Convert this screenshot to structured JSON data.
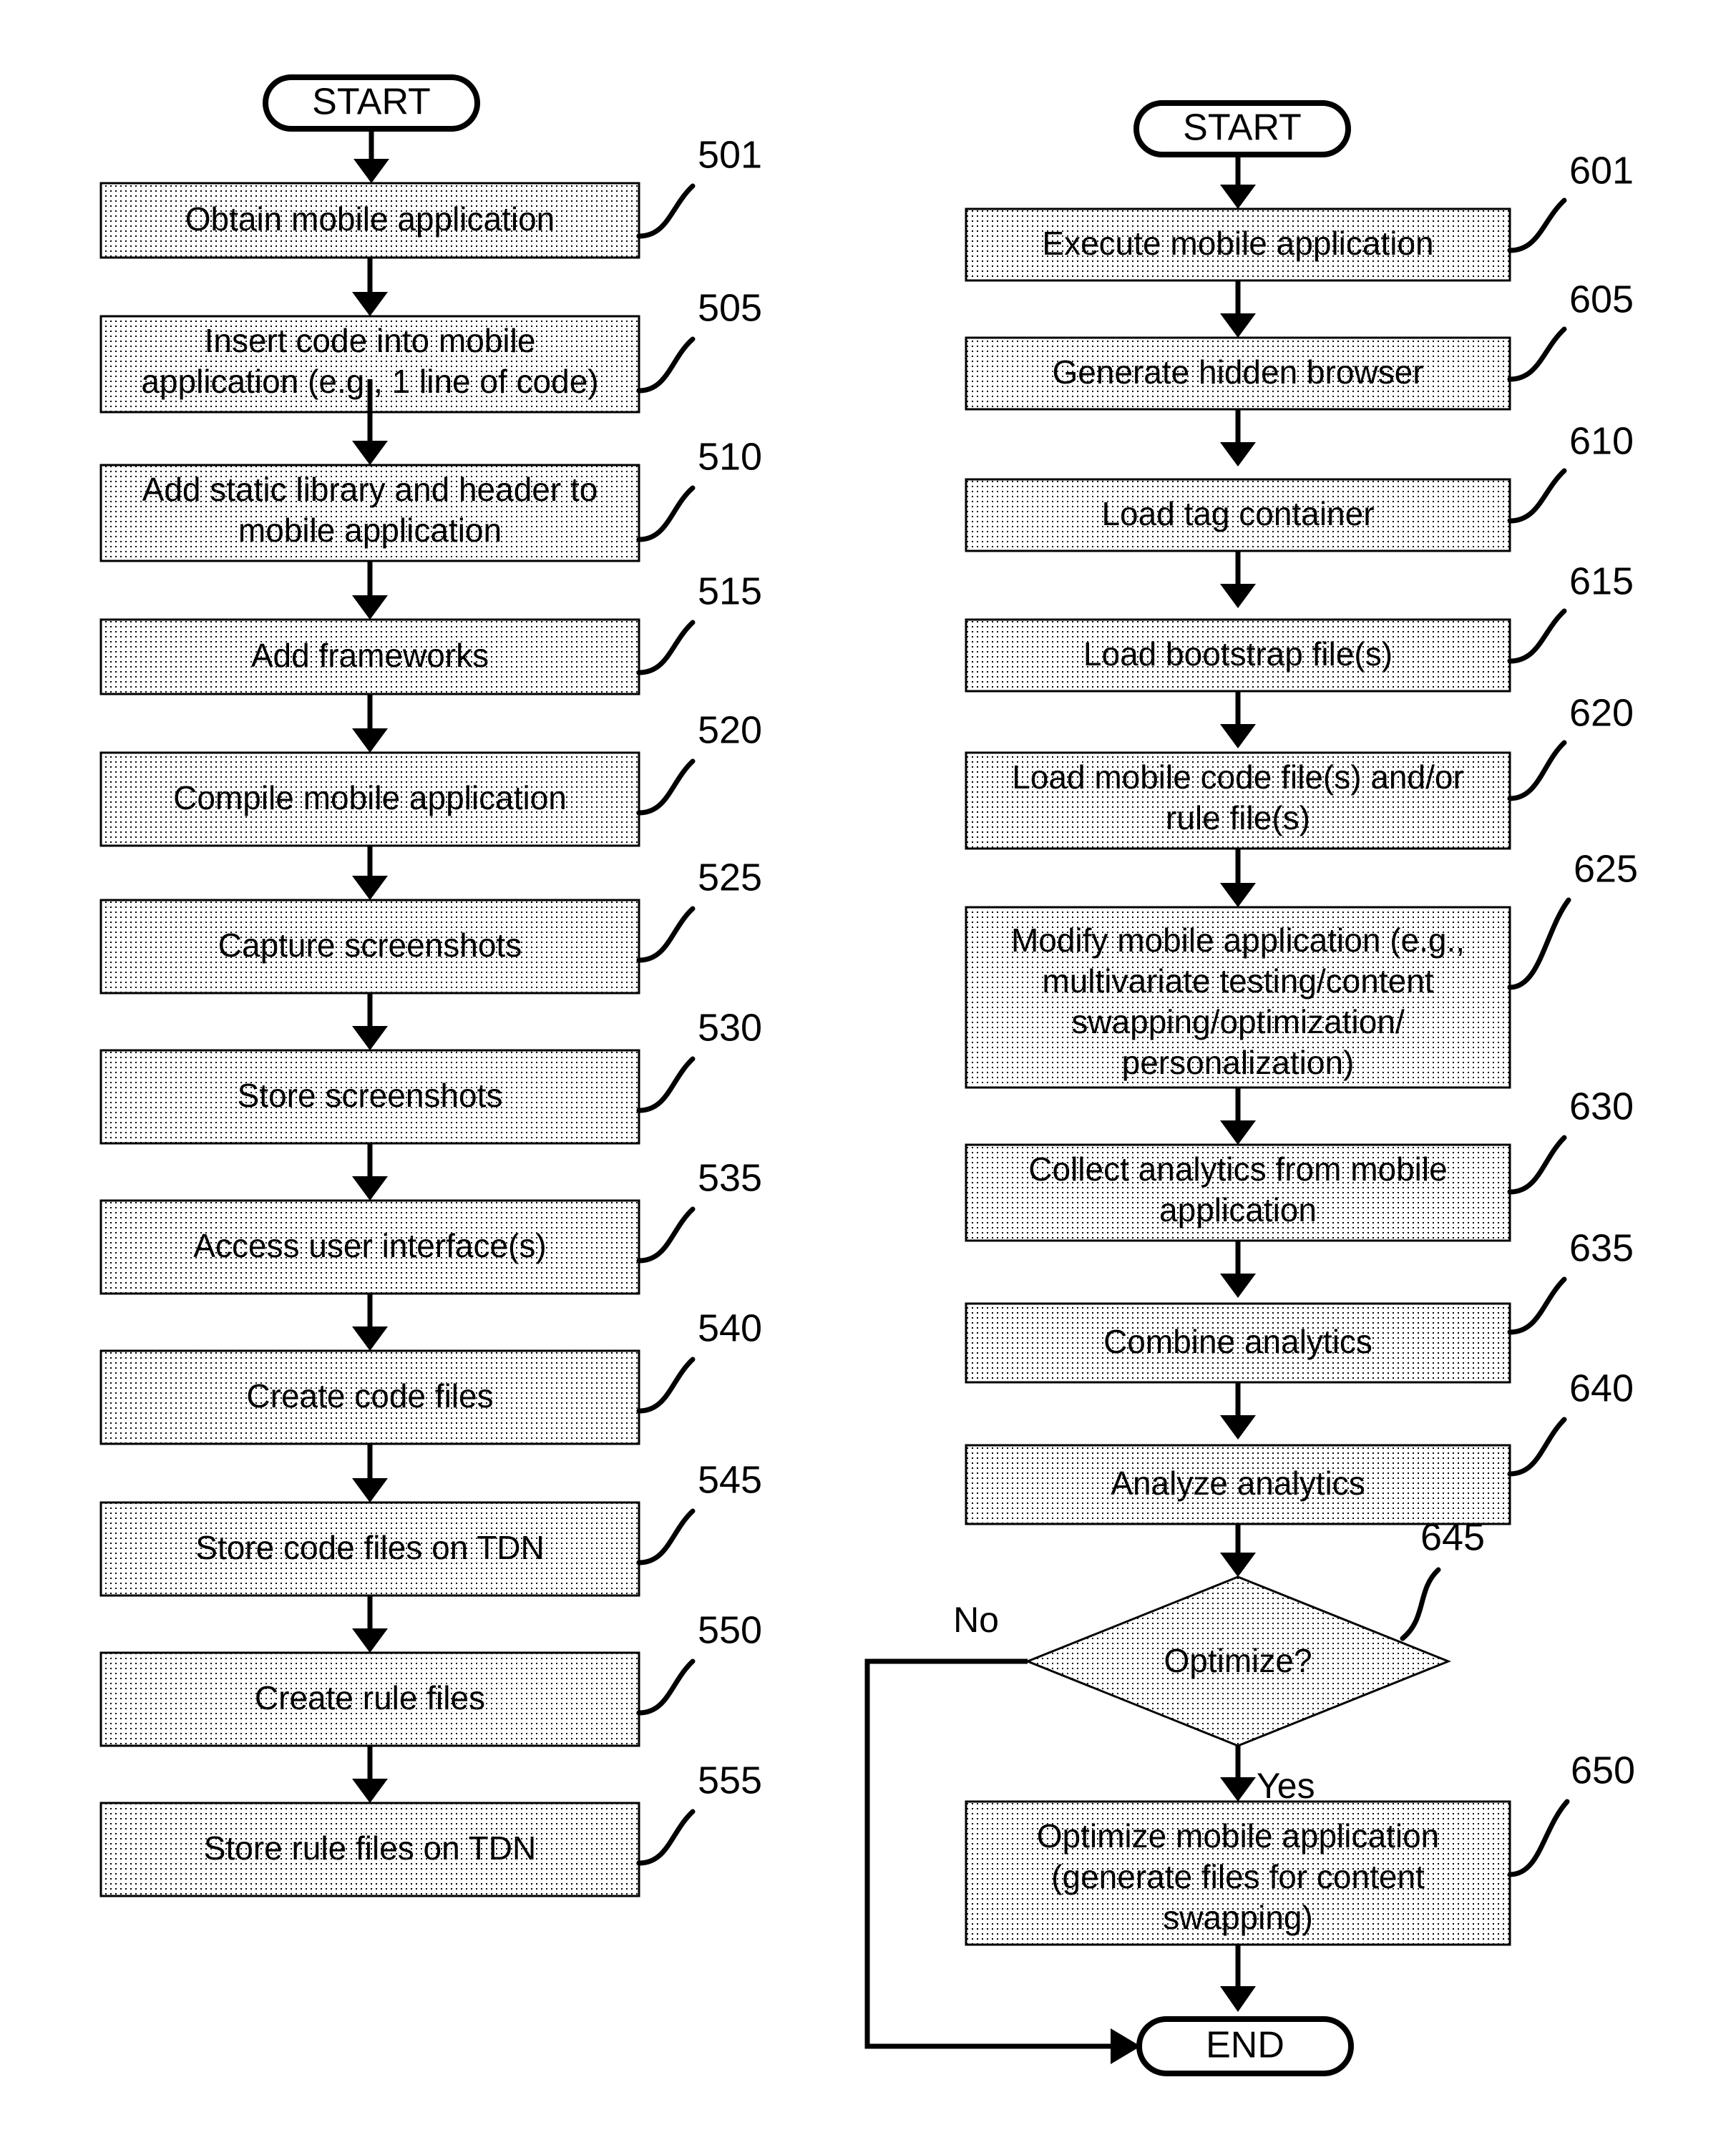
{
  "figure": {
    "background_color": "#ffffff",
    "line_color": "#000000",
    "fill_pattern": "fine-dot-stipple",
    "terminal_start_label": "START",
    "terminal_end_label": "END"
  },
  "left_flow": {
    "start_label": "START",
    "steps": [
      {
        "ref": "501",
        "text": [
          "Obtain mobile application"
        ]
      },
      {
        "ref": "505",
        "text": [
          "Insert code into mobile",
          "application (e.g., 1 line of code)"
        ]
      },
      {
        "ref": "510",
        "text": [
          "Add static library and header to",
          "mobile application"
        ]
      },
      {
        "ref": "515",
        "text": [
          "Add frameworks"
        ]
      },
      {
        "ref": "520",
        "text": [
          "Compile mobile application"
        ]
      },
      {
        "ref": "525",
        "text": [
          "Capture screenshots"
        ]
      },
      {
        "ref": "530",
        "text": [
          "Store screenshots"
        ]
      },
      {
        "ref": "535",
        "text": [
          "Access user interface(s)"
        ]
      },
      {
        "ref": "540",
        "text": [
          "Create code files"
        ]
      },
      {
        "ref": "545",
        "text": [
          "Store code files on TDN"
        ]
      },
      {
        "ref": "550",
        "text": [
          "Create rule files"
        ]
      },
      {
        "ref": "555",
        "text": [
          "Store rule files on TDN"
        ]
      }
    ]
  },
  "right_flow": {
    "start_label": "START",
    "end_label": "END",
    "steps": [
      {
        "ref": "601",
        "text": [
          "Execute mobile application"
        ]
      },
      {
        "ref": "605",
        "text": [
          "Generate hidden browser"
        ]
      },
      {
        "ref": "610",
        "text": [
          "Load tag container"
        ]
      },
      {
        "ref": "615",
        "text": [
          "Load bootstrap file(s)"
        ]
      },
      {
        "ref": "620",
        "text": [
          "Load mobile code file(s) and/or",
          "rule file(s)"
        ]
      },
      {
        "ref": "625",
        "text": [
          "Modify mobile application (e.g.,",
          "multivariate testing/content",
          "swapping/optimization/",
          "personalization)"
        ]
      },
      {
        "ref": "630",
        "text": [
          "Collect analytics from mobile",
          "application"
        ]
      },
      {
        "ref": "635",
        "text": [
          "Combine analytics"
        ]
      },
      {
        "ref": "640",
        "text": [
          "Analyze analytics"
        ]
      }
    ],
    "decision": {
      "ref": "645",
      "text": "Optimize?",
      "no_label": "No",
      "yes_label": "Yes"
    },
    "final_step": {
      "ref": "650",
      "text": [
        "Optimize mobile application",
        "(generate files for content",
        "swapping)"
      ]
    }
  }
}
